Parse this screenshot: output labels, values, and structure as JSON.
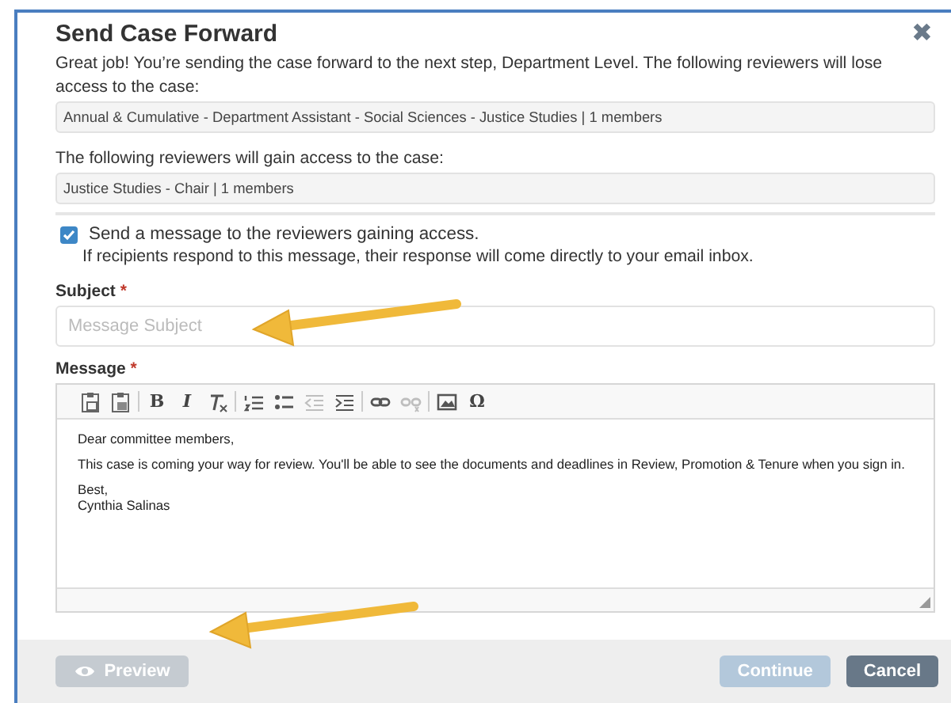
{
  "dialog": {
    "title": "Send Case Forward",
    "close_icon": "✖",
    "intro": "Great job! You’re sending the case forward to the next step, Department Level. The following reviewers will lose access to the case:",
    "losing": "Annual & Cumulative - Department Assistant - Social Sciences - Justice Studies | 1 members",
    "gain_label": "The following reviewers will gain access to the case:",
    "gaining": "Justice Studies - Chair | 1 members",
    "send_message": {
      "label": "Send a message to the reviewers gaining access.",
      "checked": true
    },
    "hint": "If recipients respond to this message, their response will come directly to your email inbox.",
    "subject": {
      "label": "Subject",
      "required_mark": "*",
      "placeholder": "Message Subject",
      "arrow": true
    },
    "message": {
      "label": "Message",
      "required_mark": "*",
      "toolbar": [
        [
          {
            "kind": "paste",
            "disabled": false
          },
          {
            "kind": "paste-text",
            "disabled": false
          }
        ],
        [
          {
            "kind": "text",
            "text": "B",
            "disabled": false
          },
          {
            "kind": "text",
            "text": "I",
            "disabled": false
          },
          {
            "kind": "clear-format",
            "disabled": false
          }
        ],
        [
          {
            "kind": "numbered-list",
            "disabled": false
          },
          {
            "kind": "bullet-list",
            "disabled": false
          },
          {
            "kind": "outdent",
            "disabled": true
          },
          {
            "kind": "indent",
            "disabled": false
          }
        ],
        [
          {
            "kind": "link",
            "disabled": false
          },
          {
            "kind": "unlink",
            "disabled": true
          }
        ],
        [
          {
            "kind": "image",
            "disabled": false
          },
          {
            "kind": "text",
            "text": "Ω",
            "disabled": false
          }
        ]
      ],
      "paragraphs": [
        [
          "Dear committee members,"
        ],
        [
          "This case is coming your way for review. You'll be able to see the documents and deadlines in Review, Promotion & Tenure when you sign in."
        ],
        [
          "Best,",
          "Cynthia Salinas"
        ]
      ]
    }
  },
  "footer": {
    "preview": {
      "label": "Preview",
      "disabled": true,
      "arrow": true
    },
    "continue": {
      "label": "Continue",
      "disabled": true
    },
    "cancel": {
      "label": "Cancel",
      "disabled": false
    }
  }
}
